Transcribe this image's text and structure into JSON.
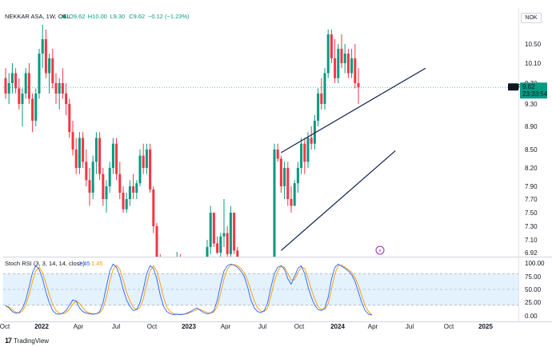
{
  "header": {
    "symbol": "NEKKAR ASA, 1W, OSL",
    "open": "O9.62",
    "high": "H10.00",
    "low": "L9.30",
    "close": "C9.62",
    "change": "−0.12 (−1.23%)"
  },
  "currency": "NOK",
  "price_badge": {
    "ticker": "NKR",
    "price": "9.62",
    "countdown": "23:33:54"
  },
  "rsi_legend": {
    "label": "Stoch RSI (3, 3, 14, 14, close)",
    "k": "1.45",
    "d": "1.45"
  },
  "footer": {
    "brand": "TradingView"
  },
  "colors": {
    "up": "#089981",
    "down": "#f23645",
    "k_line": "#2962ff",
    "d_line": "#ff9800",
    "trend": "#0d1f4f",
    "band": "#e3f2fd"
  },
  "chart_data": [
    {
      "type": "candlestick",
      "title": "NEKKAR ASA, 1W, OSL",
      "y_ticks": [
        "10.50",
        "10.10",
        "9.70",
        "9.30",
        "8.90",
        "8.50",
        "8.20",
        "7.90",
        "7.70",
        "7.50",
        "7.30",
        "7.10",
        "6.92"
      ],
      "x_ticks": [
        "Oct",
        "2022",
        "Apr",
        "Jul",
        "Oct",
        "2023",
        "Apr",
        "Jul",
        "Oct",
        "2024",
        "Apr",
        "Jul",
        "Oct",
        "2025"
      ],
      "last_price": 9.62,
      "candles": [
        {
          "o": 9.8,
          "h": 10.0,
          "l": 9.4,
          "c": 9.5
        },
        {
          "o": 9.5,
          "h": 9.9,
          "l": 9.3,
          "c": 9.7
        },
        {
          "o": 9.7,
          "h": 10.1,
          "l": 9.5,
          "c": 9.9
        },
        {
          "o": 9.9,
          "h": 10.0,
          "l": 9.5,
          "c": 9.6
        },
        {
          "o": 9.6,
          "h": 9.8,
          "l": 9.2,
          "c": 9.3
        },
        {
          "o": 9.3,
          "h": 9.6,
          "l": 8.9,
          "c": 9.5
        },
        {
          "o": 9.5,
          "h": 10.0,
          "l": 9.4,
          "c": 9.9
        },
        {
          "o": 9.9,
          "h": 10.1,
          "l": 9.3,
          "c": 9.4
        },
        {
          "o": 9.4,
          "h": 9.5,
          "l": 8.8,
          "c": 9.0
        },
        {
          "o": 9.0,
          "h": 9.6,
          "l": 8.9,
          "c": 9.5
        },
        {
          "o": 9.5,
          "h": 10.4,
          "l": 9.4,
          "c": 10.3
        },
        {
          "o": 10.3,
          "h": 10.9,
          "l": 10.0,
          "c": 10.6
        },
        {
          "o": 10.6,
          "h": 10.8,
          "l": 9.8,
          "c": 9.9
        },
        {
          "o": 9.9,
          "h": 10.3,
          "l": 9.5,
          "c": 10.2
        },
        {
          "o": 10.2,
          "h": 10.4,
          "l": 9.6,
          "c": 9.7
        },
        {
          "o": 9.7,
          "h": 9.9,
          "l": 9.3,
          "c": 9.5
        },
        {
          "o": 9.5,
          "h": 9.8,
          "l": 9.2,
          "c": 9.7
        },
        {
          "o": 9.7,
          "h": 10.0,
          "l": 9.4,
          "c": 9.5
        },
        {
          "o": 9.5,
          "h": 9.7,
          "l": 9.1,
          "c": 9.3
        },
        {
          "o": 9.3,
          "h": 9.4,
          "l": 8.7,
          "c": 8.8
        },
        {
          "o": 8.8,
          "h": 9.0,
          "l": 8.4,
          "c": 8.5
        },
        {
          "o": 8.5,
          "h": 8.7,
          "l": 8.1,
          "c": 8.2
        },
        {
          "o": 8.2,
          "h": 8.8,
          "l": 8.1,
          "c": 8.7
        },
        {
          "o": 8.7,
          "h": 8.8,
          "l": 8.2,
          "c": 8.3
        },
        {
          "o": 8.3,
          "h": 8.5,
          "l": 7.9,
          "c": 8.0
        },
        {
          "o": 8.0,
          "h": 8.2,
          "l": 7.6,
          "c": 7.8
        },
        {
          "o": 7.8,
          "h": 8.4,
          "l": 7.7,
          "c": 8.3
        },
        {
          "o": 8.3,
          "h": 8.8,
          "l": 8.1,
          "c": 8.7
        },
        {
          "o": 8.7,
          "h": 8.8,
          "l": 8.0,
          "c": 8.1
        },
        {
          "o": 8.1,
          "h": 8.2,
          "l": 7.6,
          "c": 7.7
        },
        {
          "o": 7.7,
          "h": 8.0,
          "l": 7.5,
          "c": 7.9
        },
        {
          "o": 7.9,
          "h": 8.3,
          "l": 7.8,
          "c": 8.2
        },
        {
          "o": 8.2,
          "h": 8.7,
          "l": 8.1,
          "c": 8.6
        },
        {
          "o": 8.6,
          "h": 8.7,
          "l": 8.0,
          "c": 8.1
        },
        {
          "o": 8.1,
          "h": 8.3,
          "l": 7.7,
          "c": 7.8
        },
        {
          "o": 7.8,
          "h": 7.9,
          "l": 7.5,
          "c": 7.55
        },
        {
          "o": 7.55,
          "h": 7.8,
          "l": 7.5,
          "c": 7.7
        },
        {
          "o": 7.7,
          "h": 8.0,
          "l": 7.6,
          "c": 7.9
        },
        {
          "o": 7.9,
          "h": 8.1,
          "l": 7.7,
          "c": 7.8
        },
        {
          "o": 7.8,
          "h": 8.0,
          "l": 7.7,
          "c": 7.95
        },
        {
          "o": 7.95,
          "h": 8.5,
          "l": 7.9,
          "c": 8.4
        },
        {
          "o": 8.4,
          "h": 8.6,
          "l": 8.1,
          "c": 8.2
        },
        {
          "o": 8.2,
          "h": 8.6,
          "l": 8.1,
          "c": 8.5
        },
        {
          "o": 8.5,
          "h": 8.6,
          "l": 7.8,
          "c": 7.85
        },
        {
          "o": 7.85,
          "h": 7.9,
          "l": 7.2,
          "c": 7.3
        },
        {
          "o": 7.3,
          "h": 7.35,
          "l": 6.7,
          "c": 6.75
        },
        {
          "o": 6.75,
          "h": 6.9,
          "l": 6.6,
          "c": 6.7
        },
        {
          "o": 6.7,
          "h": 6.8,
          "l": 6.5,
          "c": 6.6
        },
        {
          "o": 6.6,
          "h": 6.7,
          "l": 6.4,
          "c": 6.5
        },
        {
          "o": 6.5,
          "h": 6.6,
          "l": 6.3,
          "c": 6.4
        },
        {
          "o": 6.4,
          "h": 6.5,
          "l": 6.3,
          "c": 6.45
        },
        {
          "o": 6.45,
          "h": 6.93,
          "l": 6.4,
          "c": 6.85
        },
        {
          "o": 6.85,
          "h": 6.9,
          "l": 6.6,
          "c": 6.7
        },
        {
          "o": 6.7,
          "h": 6.8,
          "l": 6.5,
          "c": 6.6
        },
        {
          "o": 6.6,
          "h": 6.7,
          "l": 6.4,
          "c": 6.5
        },
        {
          "o": 6.5,
          "h": 6.6,
          "l": 6.3,
          "c": 6.4
        },
        {
          "o": 6.4,
          "h": 6.5,
          "l": 6.2,
          "c": 6.3
        },
        {
          "o": 6.3,
          "h": 6.4,
          "l": 6.2,
          "c": 6.35
        },
        {
          "o": 6.35,
          "h": 6.5,
          "l": 6.3,
          "c": 6.45
        },
        {
          "o": 6.45,
          "h": 6.6,
          "l": 6.4,
          "c": 6.55
        },
        {
          "o": 6.55,
          "h": 7.1,
          "l": 6.5,
          "c": 7.0
        },
        {
          "o": 7.0,
          "h": 7.6,
          "l": 6.9,
          "c": 7.5
        },
        {
          "o": 7.5,
          "h": 7.5,
          "l": 7.0,
          "c": 7.05
        },
        {
          "o": 7.05,
          "h": 7.15,
          "l": 6.9,
          "c": 6.92
        },
        {
          "o": 6.92,
          "h": 7.2,
          "l": 6.85,
          "c": 7.15
        },
        {
          "o": 7.15,
          "h": 7.7,
          "l": 7.0,
          "c": 7.2
        },
        {
          "o": 7.2,
          "h": 7.3,
          "l": 6.85,
          "c": 6.9
        },
        {
          "o": 6.9,
          "h": 7.6,
          "l": 6.85,
          "c": 7.5
        },
        {
          "o": 7.5,
          "h": 7.5,
          "l": 6.9,
          "c": 6.95
        },
        {
          "o": 6.95,
          "h": 7.0,
          "l": 6.7,
          "c": 6.75
        },
        {
          "o": 6.75,
          "h": 6.85,
          "l": 6.6,
          "c": 6.7
        },
        {
          "o": 6.7,
          "h": 6.8,
          "l": 6.5,
          "c": 6.6
        },
        {
          "o": 6.6,
          "h": 6.7,
          "l": 6.5,
          "c": 6.55
        },
        {
          "o": 6.55,
          "h": 6.65,
          "l": 6.4,
          "c": 6.5
        },
        {
          "o": 6.5,
          "h": 6.6,
          "l": 6.4,
          "c": 6.45
        },
        {
          "o": 6.45,
          "h": 6.55,
          "l": 6.3,
          "c": 6.4
        },
        {
          "o": 6.4,
          "h": 6.5,
          "l": 6.3,
          "c": 6.35
        },
        {
          "o": 6.35,
          "h": 6.45,
          "l": 6.2,
          "c": 6.3
        },
        {
          "o": 6.3,
          "h": 6.4,
          "l": 6.2,
          "c": 6.25
        },
        {
          "o": 6.25,
          "h": 6.35,
          "l": 6.1,
          "c": 6.2
        },
        {
          "o": 6.2,
          "h": 8.6,
          "l": 6.2,
          "c": 8.5
        },
        {
          "o": 8.5,
          "h": 8.6,
          "l": 8.3,
          "c": 8.35
        },
        {
          "o": 8.35,
          "h": 8.4,
          "l": 7.8,
          "c": 7.9
        },
        {
          "o": 7.9,
          "h": 8.3,
          "l": 7.7,
          "c": 8.2
        },
        {
          "o": 8.2,
          "h": 8.3,
          "l": 7.6,
          "c": 7.7
        },
        {
          "o": 7.7,
          "h": 7.9,
          "l": 7.5,
          "c": 7.6
        },
        {
          "o": 7.6,
          "h": 8.0,
          "l": 7.6,
          "c": 7.95
        },
        {
          "o": 7.95,
          "h": 8.3,
          "l": 7.8,
          "c": 8.2
        },
        {
          "o": 8.2,
          "h": 8.7,
          "l": 8.1,
          "c": 8.6
        },
        {
          "o": 8.6,
          "h": 8.7,
          "l": 8.1,
          "c": 8.3
        },
        {
          "o": 8.3,
          "h": 8.8,
          "l": 8.2,
          "c": 8.7
        },
        {
          "o": 8.7,
          "h": 8.9,
          "l": 8.5,
          "c": 8.6
        },
        {
          "o": 8.6,
          "h": 9.1,
          "l": 8.5,
          "c": 9.0
        },
        {
          "o": 9.0,
          "h": 9.6,
          "l": 8.9,
          "c": 9.5
        },
        {
          "o": 9.5,
          "h": 9.8,
          "l": 9.2,
          "c": 9.3
        },
        {
          "o": 9.3,
          "h": 10.0,
          "l": 9.2,
          "c": 9.9
        },
        {
          "o": 9.9,
          "h": 10.8,
          "l": 9.8,
          "c": 10.7
        },
        {
          "o": 10.7,
          "h": 10.8,
          "l": 10.1,
          "c": 10.2
        },
        {
          "o": 10.2,
          "h": 10.6,
          "l": 9.7,
          "c": 9.8
        },
        {
          "o": 9.8,
          "h": 10.5,
          "l": 9.7,
          "c": 10.4
        },
        {
          "o": 10.4,
          "h": 10.7,
          "l": 10.0,
          "c": 10.1
        },
        {
          "o": 10.1,
          "h": 10.5,
          "l": 9.9,
          "c": 10.3
        },
        {
          "o": 10.3,
          "h": 10.4,
          "l": 9.8,
          "c": 9.9
        },
        {
          "o": 9.9,
          "h": 10.4,
          "l": 9.8,
          "c": 10.2
        },
        {
          "o": 10.2,
          "h": 10.5,
          "l": 9.6,
          "c": 9.7
        },
        {
          "o": 9.7,
          "h": 10.0,
          "l": 9.3,
          "c": 9.62
        }
      ],
      "trendlines": [
        {
          "x0": 82,
          "y0": 8.45,
          "x1": 113,
          "y1": 10.0
        },
        {
          "x0": 82,
          "y0": 6.95,
          "x1": 104,
          "y1": 8.48
        }
      ]
    },
    {
      "type": "line",
      "title": "Stoch RSI (3, 3, 14, 14, close)",
      "y_ticks": [
        "100.00",
        "75.00",
        "50.00",
        "25.00",
        "0.00"
      ],
      "ylim": [
        0,
        100
      ],
      "bands": [
        20,
        80
      ],
      "series": [
        {
          "values": [
            20,
            15,
            8,
            5,
            6,
            14,
            30,
            55,
            82,
            95,
            88,
            70,
            45,
            25,
            10,
            4,
            3,
            5,
            10,
            20,
            30,
            28,
            15,
            8,
            5,
            4,
            3,
            4,
            8,
            25,
            55,
            85,
            98,
            92,
            75,
            50,
            30,
            18,
            10,
            12,
            25,
            50,
            80,
            95,
            90,
            70,
            40,
            18,
            8,
            4,
            2,
            3,
            2,
            3,
            5,
            8,
            12,
            15,
            10,
            6,
            4,
            5,
            10,
            30,
            60,
            85,
            95,
            98,
            96,
            92,
            85,
            75,
            55,
            30,
            15,
            8,
            6,
            10,
            25,
            55,
            80,
            92,
            95,
            88,
            70,
            60,
            75,
            90,
            95,
            80,
            55,
            35,
            20,
            12,
            10,
            15,
            35,
            70,
            92,
            98,
            94,
            90,
            85,
            78,
            65,
            45,
            25,
            10,
            3,
            1.45
          ]
        },
        {
          "values": [
            18,
            17,
            12,
            7,
            5,
            9,
            20,
            40,
            65,
            85,
            92,
            82,
            62,
            40,
            22,
            10,
            5,
            4,
            6,
            12,
            22,
            28,
            24,
            15,
            8,
            5,
            4,
            4,
            5,
            14,
            35,
            65,
            88,
            96,
            88,
            68,
            45,
            28,
            16,
            11,
            16,
            32,
            60,
            85,
            95,
            85,
            62,
            35,
            16,
            8,
            4,
            3,
            3,
            3,
            4,
            6,
            9,
            12,
            12,
            9,
            6,
            5,
            7,
            18,
            42,
            70,
            88,
            96,
            97,
            95,
            90,
            82,
            68,
            48,
            28,
            15,
            9,
            8,
            15,
            38,
            65,
            85,
            94,
            92,
            80,
            68,
            68,
            82,
            92,
            90,
            72,
            50,
            32,
            18,
            12,
            12,
            22,
            50,
            80,
            95,
            96,
            92,
            88,
            82,
            72,
            58,
            38,
            20,
            8,
            1.45
          ]
        }
      ]
    }
  ]
}
